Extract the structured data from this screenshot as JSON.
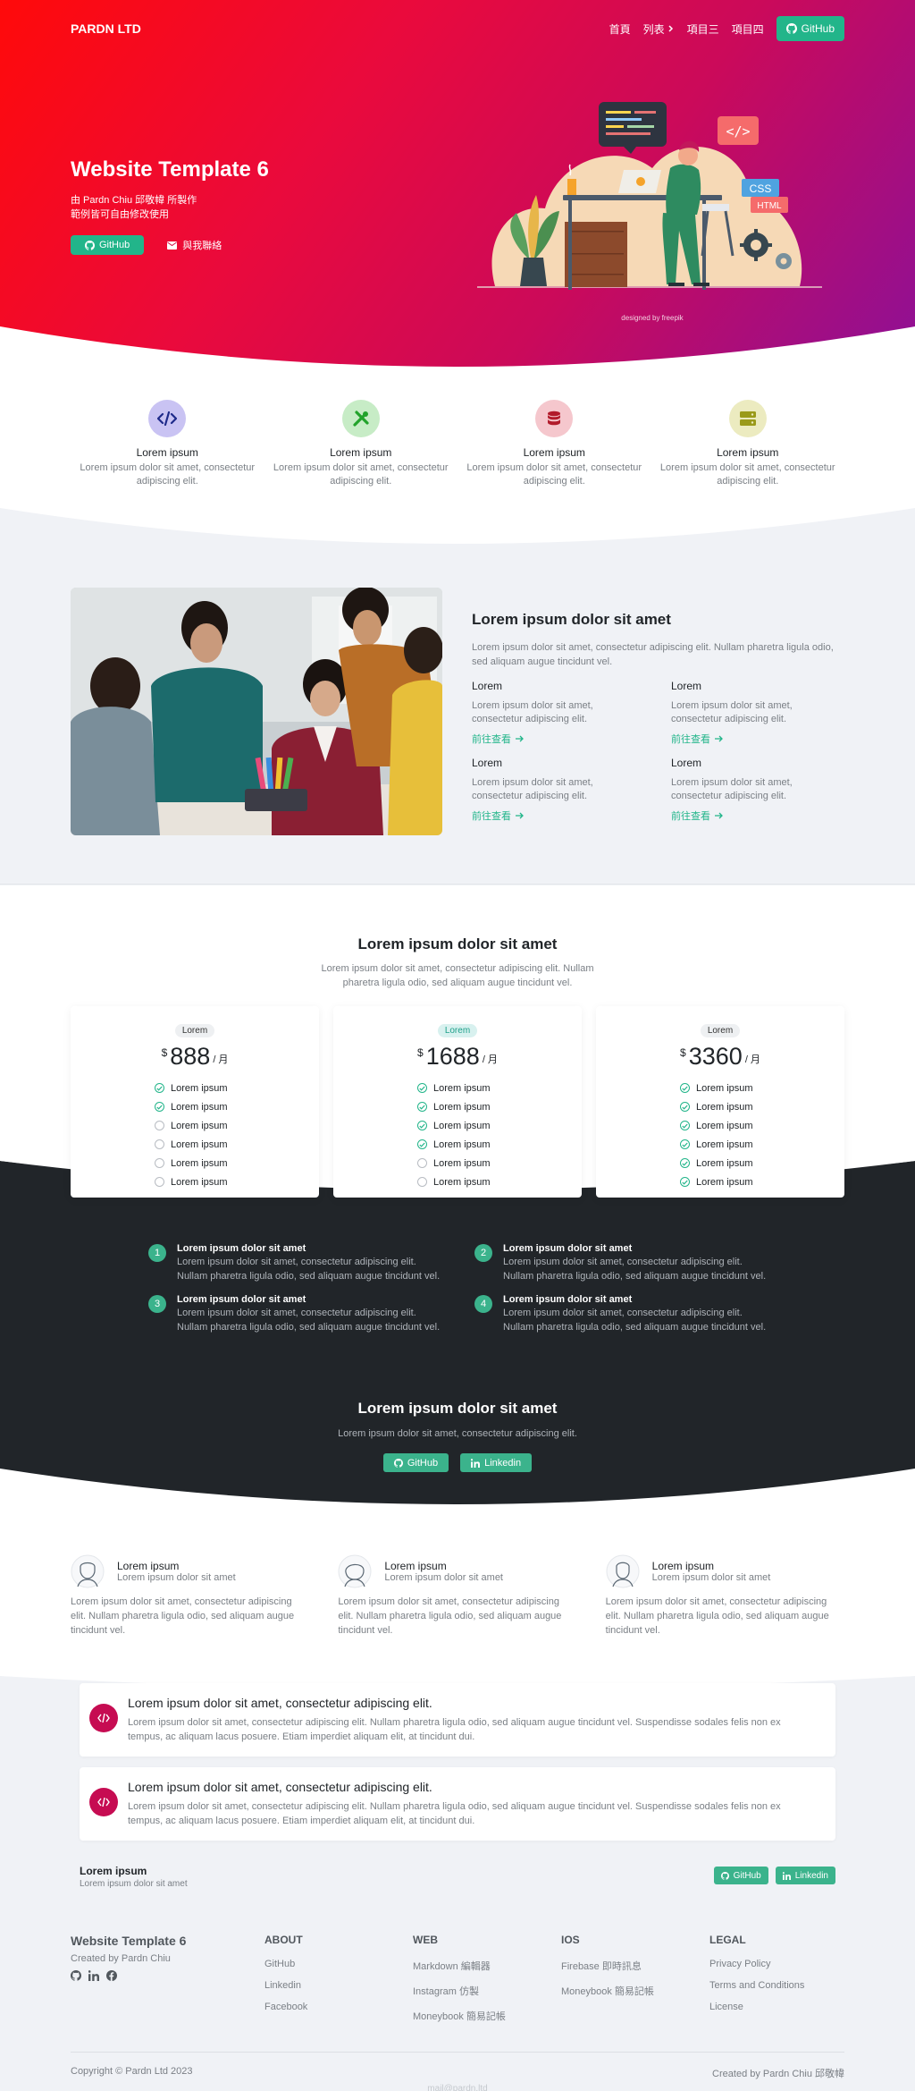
{
  "nav": {
    "brand": "PARDN LTD",
    "links": [
      "首頁",
      "列表",
      "項目三",
      "項目四"
    ],
    "github": "GitHub"
  },
  "hero": {
    "title": "Website Template 6",
    "sub1": "由 Pardn Chiu 邱敬幃 所製作",
    "sub2": "範例皆可自由修改使用",
    "github": "GitHub",
    "contact": "與我聯絡",
    "credit": "designed by freepik",
    "code_badge": "</>",
    "css_badge": "CSS",
    "html_badge": "HTML"
  },
  "features": [
    {
      "icon": "code-icon",
      "title": "Lorem ipsum",
      "desc": "Lorem ipsum dolor sit amet, consectetur adipiscing elit.",
      "bg": "#c9c3f3",
      "fg": "#1e2a8a"
    },
    {
      "icon": "tools-icon",
      "title": "Lorem ipsum",
      "desc": "Lorem ipsum dolor sit amet, consectetur adipiscing elit.",
      "bg": "#c7ecc6",
      "fg": "#22a32b"
    },
    {
      "icon": "database-icon",
      "title": "Lorem ipsum",
      "desc": "Lorem ipsum dolor sit amet, consectetur adipiscing elit.",
      "bg": "#f5c7cd",
      "fg": "#b21b2b"
    },
    {
      "icon": "server-icon",
      "title": "Lorem ipsum",
      "desc": "Lorem ipsum dolor sit amet, consectetur adipiscing elit.",
      "bg": "#ecebc0",
      "fg": "#9a9a1a"
    }
  ],
  "about": {
    "title": "Lorem ipsum dolor sit amet",
    "lead": "Lorem ipsum dolor sit amet, consectetur adipiscing elit. Nullam pharetra ligula odio, sed aliquam augue tincidunt vel.",
    "items": [
      {
        "title": "Lorem",
        "desc": "Lorem ipsum dolor sit amet, consectetur adipiscing elit.",
        "more": "前往查看"
      },
      {
        "title": "Lorem",
        "desc": "Lorem ipsum dolor sit amet, consectetur adipiscing elit.",
        "more": "前往查看"
      },
      {
        "title": "Lorem",
        "desc": "Lorem ipsum dolor sit amet, consectetur adipiscing elit.",
        "more": "前往查看"
      },
      {
        "title": "Lorem",
        "desc": "Lorem ipsum dolor sit amet, consectetur adipiscing elit.",
        "more": "前往查看"
      }
    ]
  },
  "pricing": {
    "title": "Lorem ipsum dolor sit amet",
    "desc": "Lorem ipsum dolor sit amet, consectetur adipiscing elit. Nullam pharetra ligula odio, sed aliquam augue tincidunt vel.",
    "plans": [
      {
        "tag": "Lorem",
        "currency": "$",
        "amount": "888",
        "period": "/ 月",
        "features": [
          [
            "Lorem ipsum",
            true
          ],
          [
            "Lorem ipsum",
            true
          ],
          [
            "Lorem ipsum",
            false
          ],
          [
            "Lorem ipsum",
            false
          ],
          [
            "Lorem ipsum",
            false
          ],
          [
            "Lorem ipsum",
            false
          ]
        ]
      },
      {
        "tag": "Lorem",
        "currency": "$",
        "amount": "1688",
        "period": "/ 月",
        "features": [
          [
            "Lorem ipsum",
            true
          ],
          [
            "Lorem ipsum",
            true
          ],
          [
            "Lorem ipsum",
            true
          ],
          [
            "Lorem ipsum",
            true
          ],
          [
            "Lorem ipsum",
            false
          ],
          [
            "Lorem ipsum",
            false
          ]
        ]
      },
      {
        "tag": "Lorem",
        "currency": "$",
        "amount": "3360",
        "period": "/ 月",
        "features": [
          [
            "Lorem ipsum",
            true
          ],
          [
            "Lorem ipsum",
            true
          ],
          [
            "Lorem ipsum",
            true
          ],
          [
            "Lorem ipsum",
            true
          ],
          [
            "Lorem ipsum",
            true
          ],
          [
            "Lorem ipsum",
            true
          ]
        ]
      }
    ]
  },
  "steps": [
    {
      "num": "1",
      "title": "Lorem ipsum dolor sit amet",
      "desc": "Lorem ipsum dolor sit amet, consectetur adipiscing elit. Nullam pharetra ligula odio, sed aliquam augue tincidunt vel."
    },
    {
      "num": "2",
      "title": "Lorem ipsum dolor sit amet",
      "desc": "Lorem ipsum dolor sit amet, consectetur adipiscing elit. Nullam pharetra ligula odio, sed aliquam augue tincidunt vel."
    },
    {
      "num": "3",
      "title": "Lorem ipsum dolor sit amet",
      "desc": "Lorem ipsum dolor sit amet, consectetur adipiscing elit. Nullam pharetra ligula odio, sed aliquam augue tincidunt vel."
    },
    {
      "num": "4",
      "title": "Lorem ipsum dolor sit amet",
      "desc": "Lorem ipsum dolor sit amet, consectetur adipiscing elit. Nullam pharetra ligula odio, sed aliquam augue tincidunt vel."
    }
  ],
  "dark_cta": {
    "title": "Lorem ipsum dolor sit amet",
    "desc": "Lorem ipsum dolor sit amet, consectetur adipiscing elit.",
    "github": "GitHub",
    "linkedin": "Linkedin"
  },
  "testimonials": [
    {
      "name": "Lorem ipsum",
      "role": "Lorem ipsum dolor sit amet",
      "quote": "Lorem ipsum dolor sit amet, consectetur adipiscing elit. Nullam pharetra ligula odio, sed aliquam augue tincidunt vel."
    },
    {
      "name": "Lorem ipsum",
      "role": "Lorem ipsum dolor sit amet",
      "quote": "Lorem ipsum dolor sit amet, consectetur adipiscing elit. Nullam pharetra ligula odio, sed aliquam augue tincidunt vel."
    },
    {
      "name": "Lorem ipsum",
      "role": "Lorem ipsum dolor sit amet",
      "quote": "Lorem ipsum dolor sit amet, consectetur adipiscing elit. Nullam pharetra ligula odio, sed aliquam augue tincidunt vel."
    }
  ],
  "notices": [
    {
      "title": "Lorem ipsum dolor sit amet, consectetur adipiscing elit.",
      "desc": "Lorem ipsum dolor sit amet, consectetur adipiscing elit. Nullam pharetra ligula odio, sed aliquam augue tincidunt vel. Suspendisse sodales felis non ex tempus, ac aliquam lacus posuere. Etiam imperdiet aliquam elit, at tincidunt dui."
    },
    {
      "title": "Lorem ipsum dolor sit amet, consectetur adipiscing elit.",
      "desc": "Lorem ipsum dolor sit amet, consectetur adipiscing elit. Nullam pharetra ligula odio, sed aliquam augue tincidunt vel. Suspendisse sodales felis non ex tempus, ac aliquam lacus posuere. Etiam imperdiet aliquam elit, at tincidunt dui."
    }
  ],
  "mini": {
    "title": "Lorem ipsum",
    "desc": "Lorem ipsum dolor sit amet",
    "github": "GitHub",
    "linkedin": "Linkedin"
  },
  "footer": {
    "brand": "Website Template 6",
    "created": "Created by Pardn Chiu",
    "columns": [
      {
        "title": "ABOUT",
        "links": [
          "GitHub",
          "Linkedin",
          "Facebook"
        ]
      },
      {
        "title": "WEB",
        "links": [
          "Markdown 編輯器",
          "Instagram 仿製",
          "Moneybook 簡易記帳"
        ]
      },
      {
        "title": "IOS",
        "links": [
          "Firebase 即時訊息",
          "Moneybook 簡易記帳"
        ]
      },
      {
        "title": "LEGAL",
        "links": [
          "Privacy Policy",
          "Terms and Conditions",
          "License"
        ]
      }
    ],
    "copyright": "Copyright © Pardn Ltd 2023",
    "credit": "Created by Pardn Chiu 邱敬幃",
    "mail": "mail@pardn.ltd"
  },
  "colors": {
    "accent": "#22b58a",
    "dark": "#212529",
    "grey": "#f0f2f6",
    "hero_start": "#ff0a0a",
    "hero_end": "#8e1096"
  }
}
